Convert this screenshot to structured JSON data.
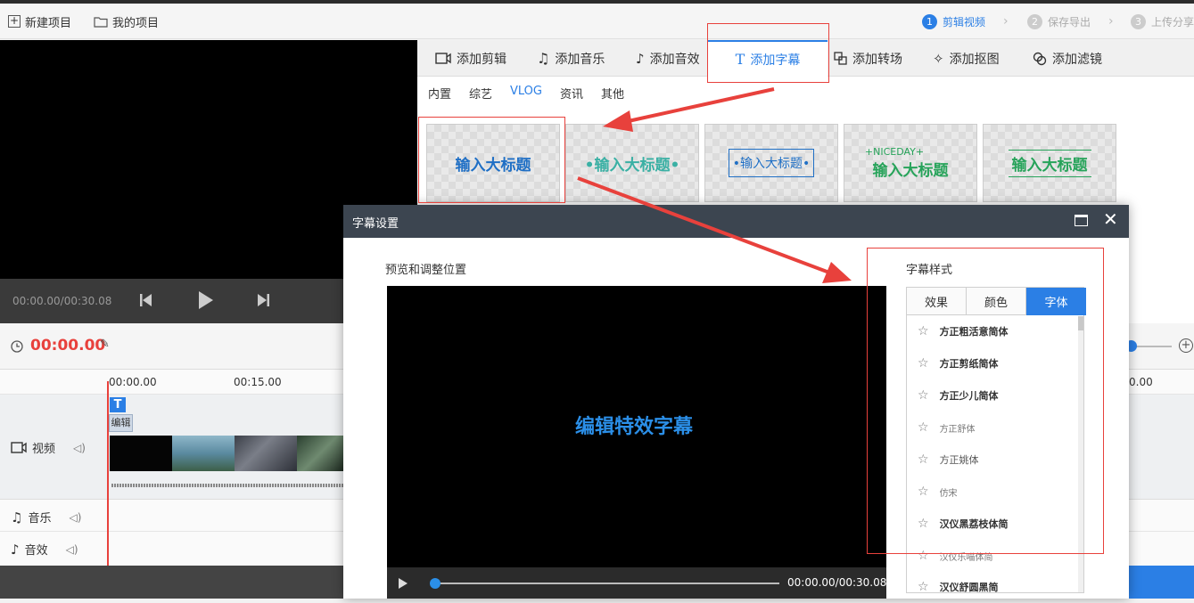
{
  "topbar": {
    "new_project": "新建项目",
    "my_projects": "我的项目",
    "steps": [
      {
        "num": "1",
        "label": "剪辑视频",
        "active": true
      },
      {
        "num": "2",
        "label": "保存导出",
        "active": false
      },
      {
        "num": "3",
        "label": "上传分享",
        "active": false
      }
    ]
  },
  "player": {
    "time": "00:00.00/00:30.08"
  },
  "tabs": [
    {
      "label": "添加剪辑",
      "icon": "clip-icon"
    },
    {
      "label": "添加音乐",
      "icon": "music-note-icon"
    },
    {
      "label": "添加音效",
      "icon": "sound-effect-icon"
    },
    {
      "label": "添加字幕",
      "icon": "text-icon",
      "active": true
    },
    {
      "label": "添加转场",
      "icon": "transition-icon"
    },
    {
      "label": "添加抠图",
      "icon": "magic-wand-icon"
    },
    {
      "label": "添加滤镜",
      "icon": "filter-icon"
    }
  ],
  "subtabs": [
    "内置",
    "综艺",
    "VLOG",
    "资讯",
    "其他"
  ],
  "subtab_active": "VLOG",
  "cards": [
    {
      "text": "输入大标题",
      "color": "#1f6fc5"
    },
    {
      "text": "•输入大标题•",
      "color": "#3ab0a4"
    },
    {
      "text": "•输入大标题•",
      "color": "#1f6fc5"
    },
    {
      "text": "输入大标题",
      "small": "+NICEDAY+",
      "color": "#27a35a"
    },
    {
      "text": "输入大标题",
      "color": "#27a35a"
    }
  ],
  "timeline": {
    "current_time": "00:00.00",
    "ticks": [
      "00:00.00",
      "00:15.00",
      "0.00"
    ],
    "clip_label": "编辑",
    "clip_badge": "T",
    "tracks": [
      {
        "label": "视频"
      },
      {
        "label": "音乐"
      },
      {
        "label": "音效"
      }
    ]
  },
  "dialog": {
    "title": "字幕设置",
    "preview_label": "预览和调整位置",
    "preview_text": "编辑特效字幕",
    "time": "00:00.00/00:30.08",
    "style_label": "字幕样式",
    "font_tabs": [
      "效果",
      "颜色",
      "字体"
    ],
    "font_tab_active": "字体",
    "fonts": [
      "方正粗活意简体",
      "方正剪纸简体",
      "方正少儿简体",
      "方正舒体",
      "方正姚体",
      "仿宋",
      "汉仪黑荔枝体简",
      "汉仪乐喵体简",
      "汉仪舒圆黑简"
    ]
  },
  "colors": {
    "accent": "#2b7fe5",
    "annotation": "#e8413c",
    "time_red": "#e8413c"
  }
}
